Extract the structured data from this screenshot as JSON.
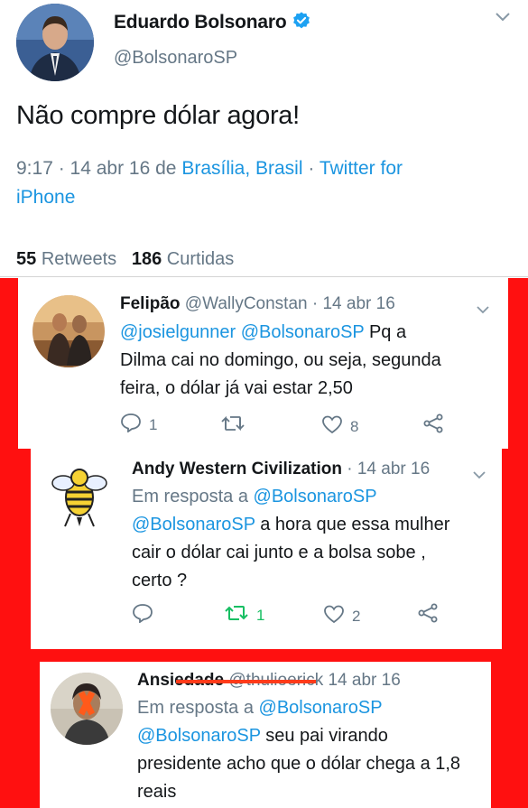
{
  "main_tweet": {
    "display_name": "Eduardo Bolsonaro",
    "handle": "@BolsonaroSP",
    "text": "Não compre dólar agora!",
    "time": "9:17 · 14 abr 16 de ",
    "location": "Brasília, Brasil",
    "separator": " · ",
    "source_line1": "Twitter for",
    "source_line2": "iPhone",
    "retweets_count": "55",
    "retweets_label": "Retweets",
    "likes_count": "186",
    "likes_label": "Curtidas"
  },
  "replies": [
    {
      "name": "Felipão",
      "handle": "@WallyConstan",
      "date": " · 14 abr 16",
      "mention1": "@josielgunner",
      "mention2": "@BolsonaroSP",
      "text_a": " Pq a",
      "text_b": "Dilma cai no domingo, ou seja, segunda",
      "text_c": "feira, o dólar já vai estar 2,50",
      "replies_count": "1",
      "retweets_count": "",
      "likes_count": "8"
    },
    {
      "name": "Andy Western Civilization",
      "date": " · 14 abr 16",
      "reply_prefix": "Em resposta a ",
      "reply_to": "@BolsonaroSP",
      "mention": "@BolsonaroSP",
      "text_a": " a hora que essa mulher",
      "text_b": "cair o dólar cai junto e a bolsa sobe ,",
      "text_c": "certo ?",
      "replies_count": "",
      "retweets_count": "1",
      "likes_count": "2"
    },
    {
      "name": "Ansiedade",
      "handle_struck": "@thulioerick",
      "date": " 14 abr 16",
      "reply_prefix": "Em resposta a ",
      "reply_to": "@BolsonaroSP",
      "mention": "@BolsonaroSP",
      "text_a": " seu pai virando",
      "text_b": "presidente acho que o dólar chega a 1,8",
      "text_c": "reais"
    }
  ],
  "colors": {
    "link": "#1b95e0",
    "secondary": "#657786",
    "frame_red": "#ff1010",
    "retweet_green": "#17bf63",
    "verified_blue": "#1da1f2"
  }
}
